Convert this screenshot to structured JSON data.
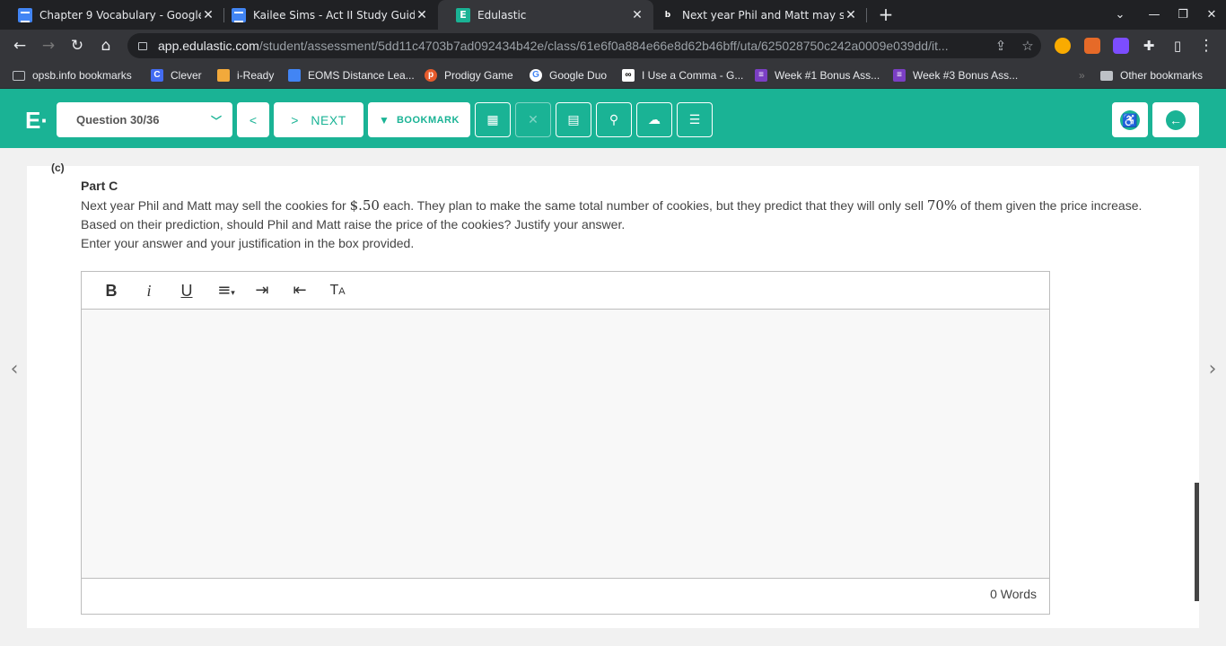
{
  "tabs": [
    {
      "title": "Chapter 9 Vocabulary - Google D",
      "favicon": "docs-icon"
    },
    {
      "title": "Kailee Sims - Act II Study Guide -",
      "favicon": "docs-icon"
    },
    {
      "title": "Edulastic",
      "favicon": "edulastic-icon",
      "active": true
    },
    {
      "title": "Next year Phil and Matt may sell",
      "favicon": "brainly-icon"
    }
  ],
  "address": {
    "host": "app.edulastic.com",
    "path": "/student/assessment/5dd11c4703b7ad092434b42e/class/61e6f0a884e66e8d62b46bff/uta/625028750c242a0009e039dd/it..."
  },
  "bookmarks": [
    {
      "label": "opsb.info bookmarks"
    },
    {
      "label": "Clever"
    },
    {
      "label": "i-Ready"
    },
    {
      "label": "EOMS Distance Lea..."
    },
    {
      "label": "Prodigy Game"
    },
    {
      "label": "Google Duo"
    },
    {
      "label": "I Use a Comma - G..."
    },
    {
      "label": "Week #1 Bonus Ass..."
    },
    {
      "label": "Week #3 Bonus Ass..."
    },
    {
      "label": "Other bookmarks"
    }
  ],
  "header": {
    "question_select": "Question 30/36",
    "next_label": "NEXT",
    "bookmark_label": "BOOKMARK"
  },
  "question": {
    "part_letter": "(c)",
    "part_title": "Part C",
    "stem_1": "Next year Phil and Matt may sell the cookies for ",
    "price": "$.50",
    "stem_2": " each. They plan to make the same total number of cookies, but they predict that they will only sell ",
    "percent": "70%",
    "stem_3": " of them given the price increase. Based on their prediction, should Phil and Matt raise the price of the cookies? Justify your answer.",
    "instruction": "Enter your answer and your justification in the box provided."
  },
  "editor": {
    "word_count": "0 Words"
  },
  "colors": {
    "brand": "#1ab395",
    "tabstrip": "#202124",
    "toolbar": "#35363a"
  }
}
